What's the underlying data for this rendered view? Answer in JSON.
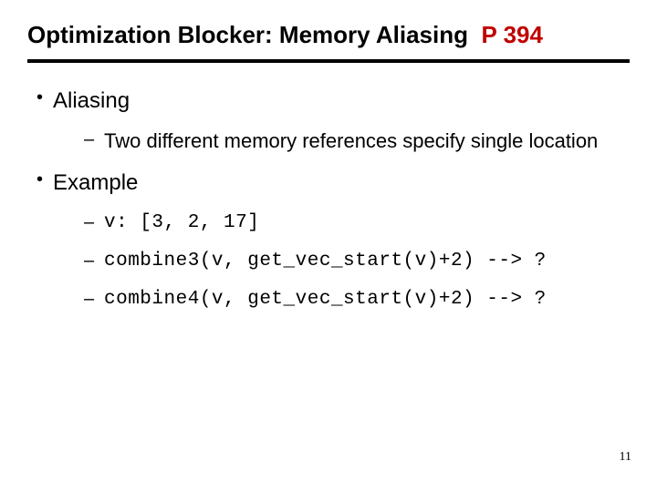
{
  "title_main": "Optimization Blocker: Memory Aliasing",
  "title_highlight": "P 394",
  "bullets": [
    {
      "label": "Aliasing",
      "sub": [
        {
          "text": "Two different memory references specify single location",
          "mono": false
        }
      ]
    },
    {
      "label": "Example",
      "sub": [
        {
          "text": "v: [3, 2, 17]",
          "mono": true
        },
        {
          "text": "combine3(v, get_vec_start(v)+2) --> ?",
          "mono": true
        },
        {
          "text": "combine4(v, get_vec_start(v)+2) --> ?",
          "mono": true
        }
      ]
    }
  ],
  "page_number": "11"
}
